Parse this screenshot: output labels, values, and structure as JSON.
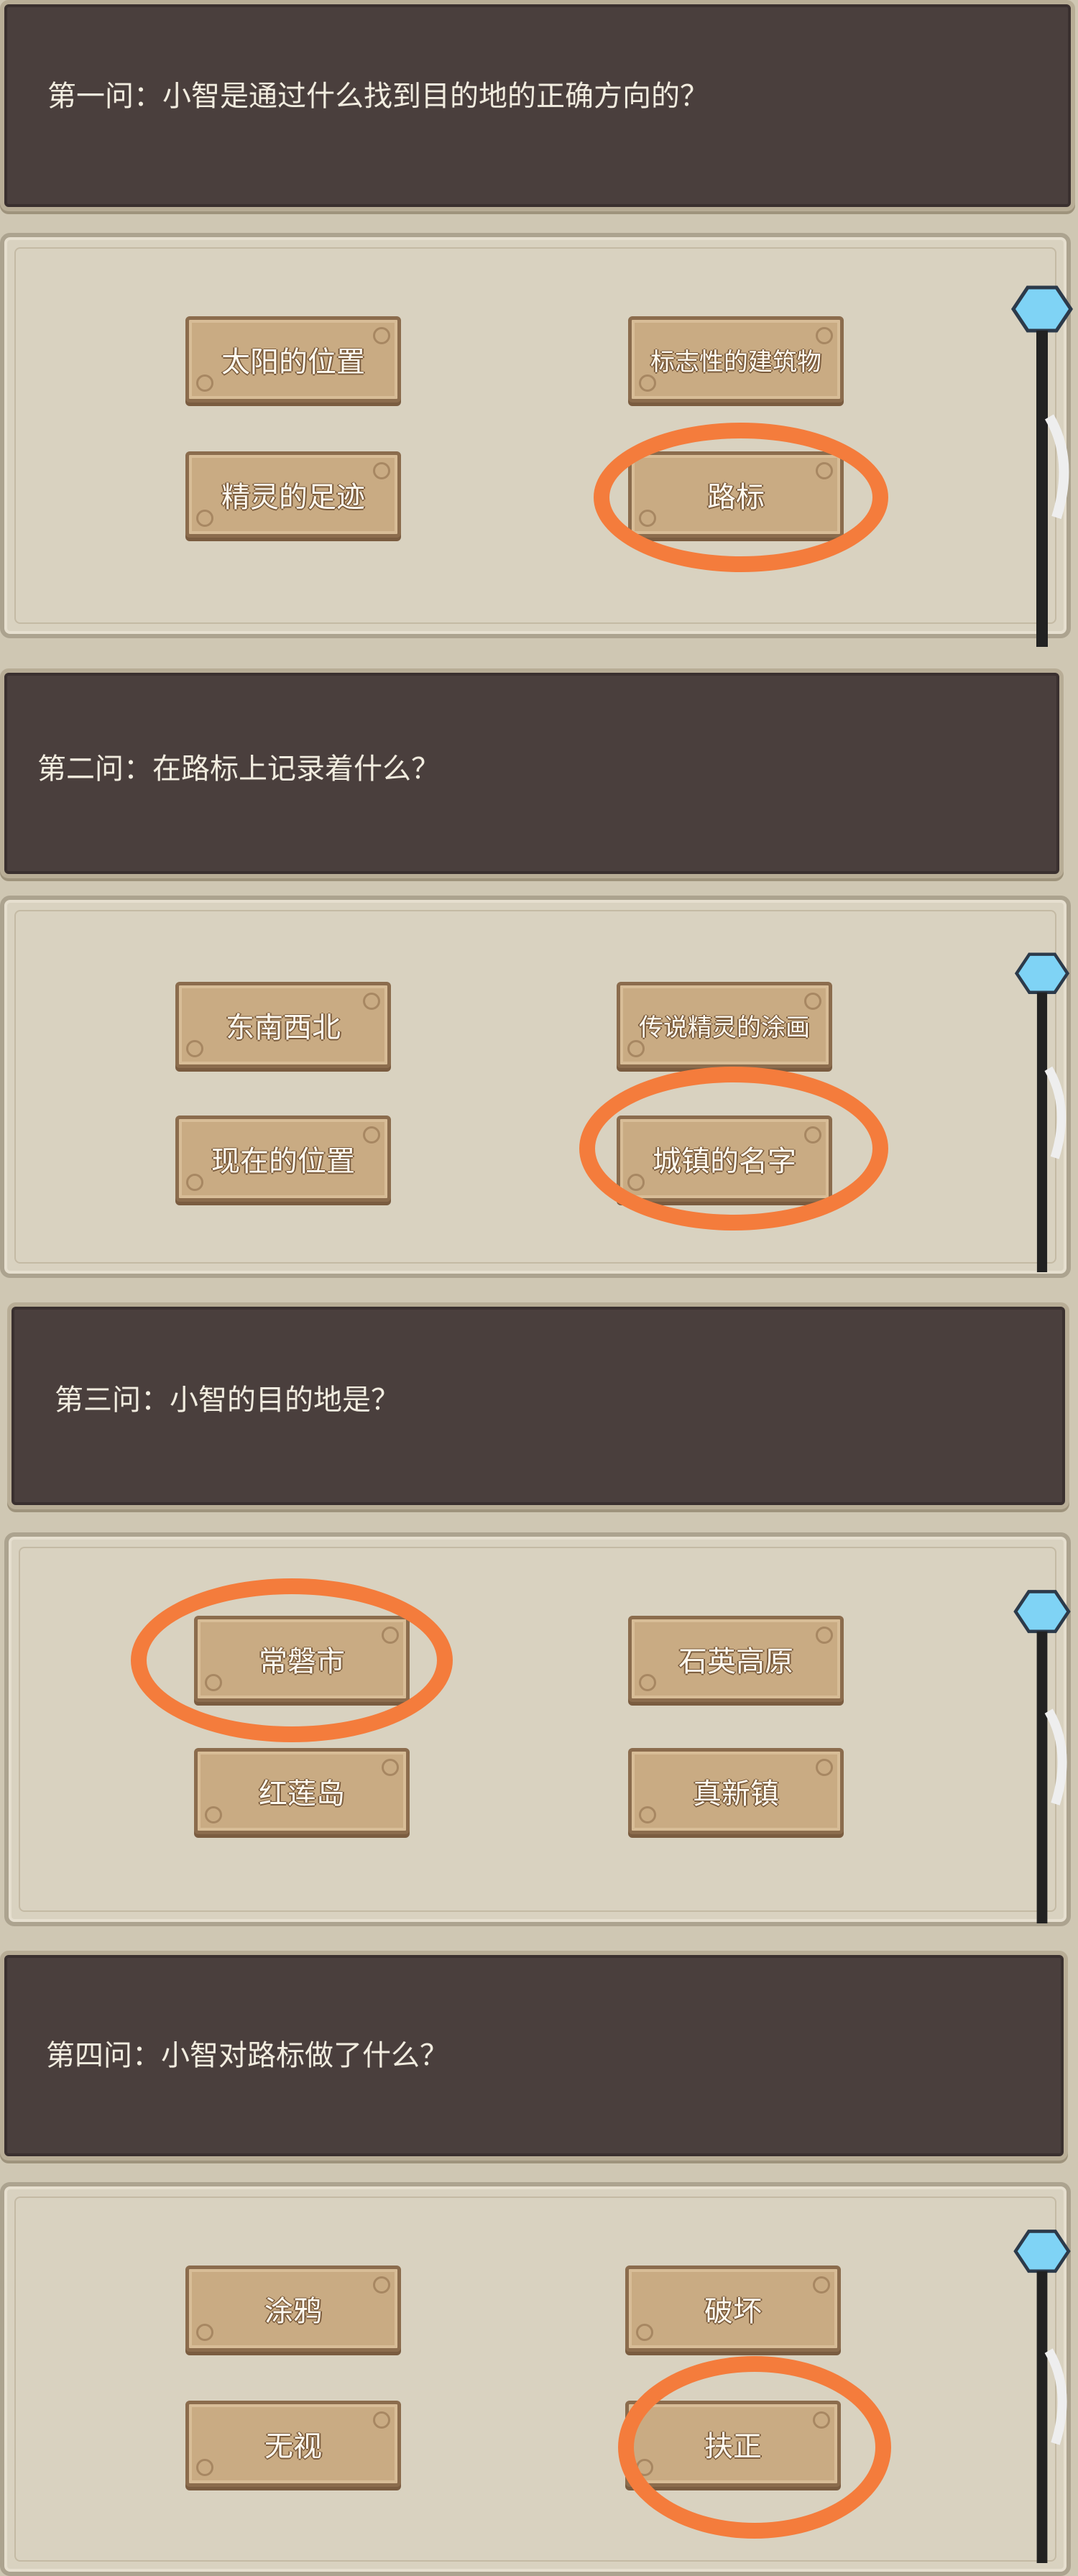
{
  "questions": [
    {
      "text": "第一问：小智是通过什么找到目的地的正确方向的？",
      "answers": [
        "太阳的位置",
        "标志性的建筑物",
        "精灵的足迹",
        "路标"
      ]
    },
    {
      "text": "第二问：在路标上记录着什么？",
      "answers": [
        "东南西北",
        "传说精灵的涂画",
        "现在的位置",
        "城镇的名字"
      ]
    },
    {
      "text": "第三问：小智的目的地是？",
      "answers": [
        "常磐市",
        "石英高原",
        "红莲岛",
        "真新镇"
      ]
    },
    {
      "text": "第四问：小智对路标做了什么？",
      "answers": [
        "涂鸦",
        "破坏",
        "无视",
        "扶正"
      ]
    }
  ],
  "colors": {
    "highlight": "#f47c3c",
    "banner": "#4a3f3d",
    "button": "#c9ab83"
  },
  "icons": {
    "staff": "crystal-staff-icon"
  }
}
